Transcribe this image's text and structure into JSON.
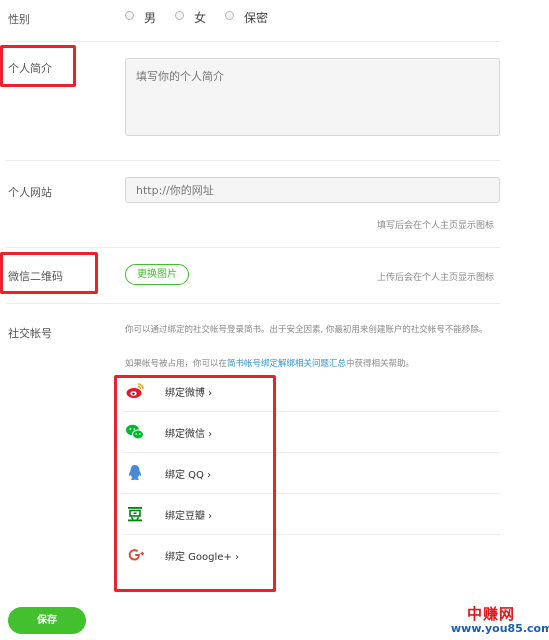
{
  "gender": {
    "label": "性别",
    "options": [
      "男",
      "女",
      "保密"
    ]
  },
  "bio": {
    "label": "个人简介",
    "placeholder": "填写你的个人简介"
  },
  "website": {
    "label": "个人网站",
    "placeholder": "http://你的网址",
    "hint": "填写后会在个人主页显示图标"
  },
  "wechat_qr": {
    "label": "微信二维码",
    "button": "更换图片",
    "hint": "上传后会在个人主页显示图标"
  },
  "social": {
    "label": "社交帐号",
    "description": "你可以通过绑定的社交帐号登录简书。出于安全因素, 你最初用来创建账户的社交帐号不能移除。",
    "occupied_prefix": "如果帐号被占用，你可以在",
    "occupied_link": "简书帐号绑定解绑相关问题汇总",
    "occupied_suffix": "中获得相关帮助。",
    "items": [
      {
        "label": "绑定微博 ›",
        "icon": "weibo-icon",
        "color": "#e6162d"
      },
      {
        "label": "绑定微信 ›",
        "icon": "wechat-icon",
        "color": "#00bb29"
      },
      {
        "label": "绑定 QQ ›",
        "icon": "qq-icon",
        "color": "#498ad5"
      },
      {
        "label": "绑定豆瓣 ›",
        "icon": "douban-icon",
        "color": "#00820f"
      },
      {
        "label": "绑定 Google+ ›",
        "icon": "google-plus-icon",
        "color": "#dd4b39"
      }
    ]
  },
  "save_button": "保存",
  "watermark": {
    "name": "中赚网",
    "url": "www.you85.com"
  },
  "colors": {
    "accent": "#42c02e",
    "annotation_red": "#e8232b",
    "link": "#3194d0"
  }
}
